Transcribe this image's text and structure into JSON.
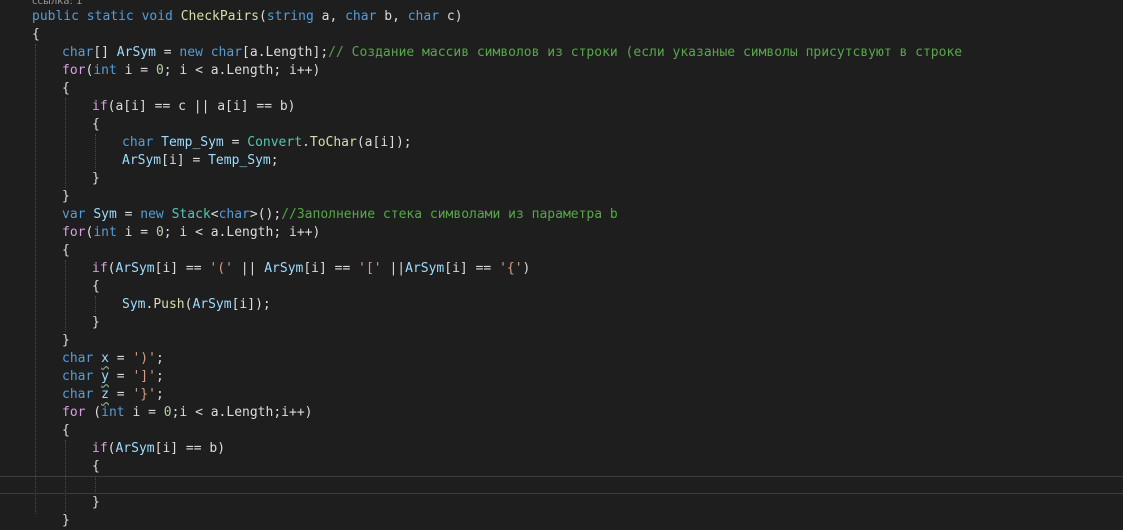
{
  "editor": {
    "codelens": "ссылка: 1",
    "lines": [
      [
        [
          "k",
          "public static void "
        ],
        [
          "m",
          "CheckPairs"
        ],
        [
          "p",
          "("
        ],
        [
          "k",
          "string"
        ],
        [
          "p",
          " a, "
        ],
        [
          "k",
          "char"
        ],
        [
          "p",
          " b, "
        ],
        [
          "k",
          "char"
        ],
        [
          "p",
          " c)"
        ]
      ],
      [
        [
          "p",
          "{"
        ]
      ],
      [
        [
          "k",
          "char"
        ],
        [
          "p",
          "[] "
        ],
        [
          "v",
          "ArSym"
        ],
        [
          "p",
          " = "
        ],
        [
          "k",
          "new char"
        ],
        [
          "p",
          "[a.Length];"
        ],
        [
          "c",
          "// Создание массив символов из строки (если указаные символы присутсвуют в строке"
        ]
      ],
      [
        [
          "ctl",
          "for"
        ],
        [
          "p",
          "("
        ],
        [
          "k",
          "int"
        ],
        [
          "p",
          " i = "
        ],
        [
          "n",
          "0"
        ],
        [
          "p",
          "; i < a.Length; i++)"
        ]
      ],
      [
        [
          "p",
          "{"
        ]
      ],
      [
        [
          "ctl",
          "if"
        ],
        [
          "p",
          "(a[i] == c || a[i] == b)"
        ]
      ],
      [
        [
          "p",
          "{"
        ]
      ],
      [
        [
          "k",
          "char "
        ],
        [
          "v",
          "Temp_Sym"
        ],
        [
          "p",
          " = "
        ],
        [
          "t",
          "Convert"
        ],
        [
          "p",
          "."
        ],
        [
          "m",
          "ToChar"
        ],
        [
          "p",
          "(a[i]);"
        ]
      ],
      [
        [
          "v",
          "ArSym"
        ],
        [
          "p",
          "[i] = "
        ],
        [
          "v",
          "Temp_Sym"
        ],
        [
          "p",
          ";"
        ]
      ],
      [
        [
          "p",
          "}"
        ]
      ],
      [
        [
          "p",
          "}"
        ]
      ],
      [
        [
          "k",
          "var "
        ],
        [
          "v",
          "Sym"
        ],
        [
          "p",
          " = "
        ],
        [
          "k",
          "new "
        ],
        [
          "t",
          "Stack"
        ],
        [
          "p",
          "<"
        ],
        [
          "k",
          "char"
        ],
        [
          "p",
          ">();"
        ],
        [
          "c",
          "//Заполнение стека символами из параметра b"
        ]
      ],
      [
        [
          "ctl",
          "for"
        ],
        [
          "p",
          "("
        ],
        [
          "k",
          "int"
        ],
        [
          "p",
          " i = "
        ],
        [
          "n",
          "0"
        ],
        [
          "p",
          "; i < a.Length; i++)"
        ]
      ],
      [
        [
          "p",
          "{"
        ]
      ],
      [
        [
          "ctl",
          "if"
        ],
        [
          "p",
          "("
        ],
        [
          "v",
          "ArSym"
        ],
        [
          "p",
          "[i] == "
        ],
        [
          "s",
          "'('"
        ],
        [
          "p",
          " || "
        ],
        [
          "v",
          "ArSym"
        ],
        [
          "p",
          "[i] == "
        ],
        [
          "s",
          "'['"
        ],
        [
          "p",
          " ||"
        ],
        [
          "v",
          "ArSym"
        ],
        [
          "p",
          "[i] == "
        ],
        [
          "s",
          "'{'"
        ],
        [
          "p",
          ")"
        ]
      ],
      [
        [
          "p",
          "{"
        ]
      ],
      [
        [
          "v",
          "Sym"
        ],
        [
          "p",
          "."
        ],
        [
          "m",
          "Push"
        ],
        [
          "p",
          "("
        ],
        [
          "v",
          "ArSym"
        ],
        [
          "p",
          "[i]);"
        ]
      ],
      [
        [
          "p",
          "}"
        ]
      ],
      [
        [
          "p",
          "}"
        ]
      ],
      [
        [
          "k",
          "char "
        ],
        [
          "v",
          "x"
        ],
        [
          "p",
          " = "
        ],
        [
          "s",
          "')'"
        ],
        [
          "p",
          ";"
        ]
      ],
      [
        [
          "k",
          "char "
        ],
        [
          "v",
          "y"
        ],
        [
          "p",
          " = "
        ],
        [
          "s",
          "']'"
        ],
        [
          "p",
          ";"
        ]
      ],
      [
        [
          "k",
          "char "
        ],
        [
          "v",
          "z"
        ],
        [
          "p",
          " = "
        ],
        [
          "s",
          "'}'"
        ],
        [
          "p",
          ";"
        ]
      ],
      [
        [
          "ctl",
          "for"
        ],
        [
          "p",
          " ("
        ],
        [
          "k",
          "int"
        ],
        [
          "p",
          " i = "
        ],
        [
          "n",
          "0"
        ],
        [
          "p",
          ";i < a.Length;i++)"
        ]
      ],
      [
        [
          "p",
          "{"
        ]
      ],
      [
        [
          "ctl",
          "if"
        ],
        [
          "p",
          "("
        ],
        [
          "v",
          "ArSym"
        ],
        [
          "p",
          "[i] == b)"
        ]
      ],
      [
        [
          "p",
          "{"
        ]
      ],
      [],
      [
        [
          "p",
          "}"
        ]
      ],
      [
        [
          "p",
          "}"
        ]
      ]
    ],
    "indents": [
      0,
      0,
      1,
      1,
      1,
      2,
      2,
      3,
      3,
      2,
      1,
      1,
      1,
      1,
      2,
      2,
      3,
      2,
      1,
      1,
      1,
      1,
      1,
      1,
      2,
      2,
      3,
      2,
      1
    ],
    "squiggles": [
      [
        19,
        1
      ],
      [
        20,
        1
      ],
      [
        21,
        1
      ]
    ],
    "current_line": 26
  }
}
